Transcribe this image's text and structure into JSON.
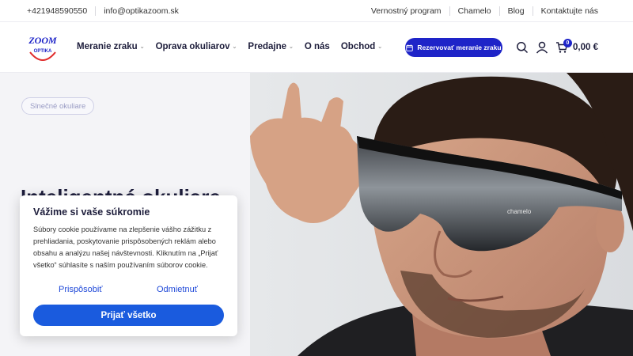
{
  "topbar": {
    "phone": "+421948590550",
    "email": "info@optikazoom.sk",
    "links": [
      "Vernostný program",
      "Chamelo",
      "Blog",
      "Kontaktujte nás"
    ]
  },
  "logo": {
    "text_top": "ZOOM",
    "text_bottom": "OPTIKA"
  },
  "nav": {
    "items": [
      {
        "label": "Meranie zraku",
        "dropdown": true
      },
      {
        "label": "Oprava okuliarov",
        "dropdown": true
      },
      {
        "label": "Predajne",
        "dropdown": true
      },
      {
        "label": "O nás",
        "dropdown": false
      },
      {
        "label": "Obchod",
        "dropdown": true
      }
    ]
  },
  "header": {
    "book_button": "Rezervovať meranie zraku",
    "cart_count": "0",
    "cart_total": "0,00 €",
    "icons": [
      "search-icon",
      "user-icon",
      "cart-icon"
    ]
  },
  "hero": {
    "tag": "Slnečné okuliare",
    "title": "Inteligentné okuliare",
    "glasses_brand": "chamelo"
  },
  "cookie": {
    "title": "Vážime si vaše súkromie",
    "text": "Súbory cookie používame na zlepšenie vášho zážitku z prehliadania, poskytovanie prispôsobených reklám alebo obsahu a analýzu našej návštevnosti. Kliknutím na „Prijať všetko“ súhlasíte s naším používaním súborov cookie.",
    "customize": "Prispôsobiť",
    "reject": "Odmietnuť",
    "accept": "Prijať všetko"
  },
  "colors": {
    "brand_blue": "#1e24c8",
    "accept_blue": "#1a5bde",
    "logo_red": "#e02b2b"
  }
}
